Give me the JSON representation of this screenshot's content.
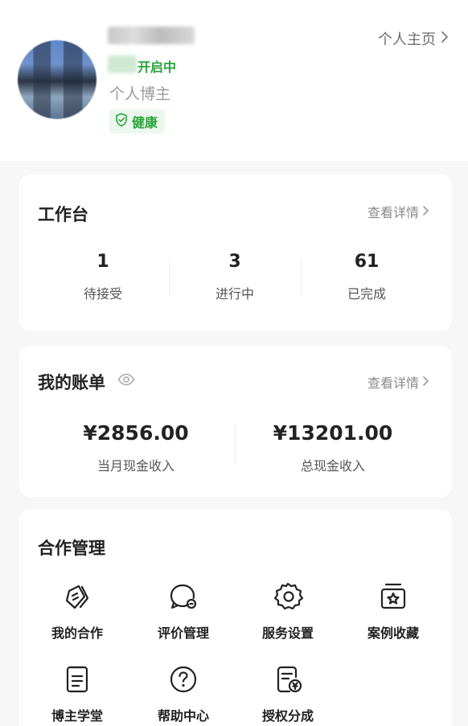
{
  "profile": {
    "status": "开启中",
    "role": "个人博主",
    "health": "健康",
    "homepage_link": "个人主页"
  },
  "workbench": {
    "title": "工作台",
    "detail_link": "查看详情",
    "stats": [
      {
        "value": "1",
        "label": "待接受"
      },
      {
        "value": "3",
        "label": "进行中"
      },
      {
        "value": "61",
        "label": "已完成"
      }
    ]
  },
  "bill": {
    "title": "我的账单",
    "detail_link": "查看详情",
    "items": [
      {
        "value": "¥2856.00",
        "label": "当月现金收入"
      },
      {
        "value": "¥13201.00",
        "label": "总现金收入"
      }
    ]
  },
  "cooperation": {
    "title": "合作管理",
    "items": [
      {
        "label": "我的合作",
        "icon": "cooperation-icon"
      },
      {
        "label": "评价管理",
        "icon": "review-icon"
      },
      {
        "label": "服务设置",
        "icon": "gear-icon"
      },
      {
        "label": "案例收藏",
        "icon": "favorite-box-icon"
      },
      {
        "label": "博主学堂",
        "icon": "document-icon"
      },
      {
        "label": "帮助中心",
        "icon": "help-icon"
      },
      {
        "label": "授权分成",
        "icon": "revenue-share-icon"
      }
    ]
  },
  "colors": {
    "accent_green": "#2aa43a",
    "page_background": "#f7f7f8"
  }
}
